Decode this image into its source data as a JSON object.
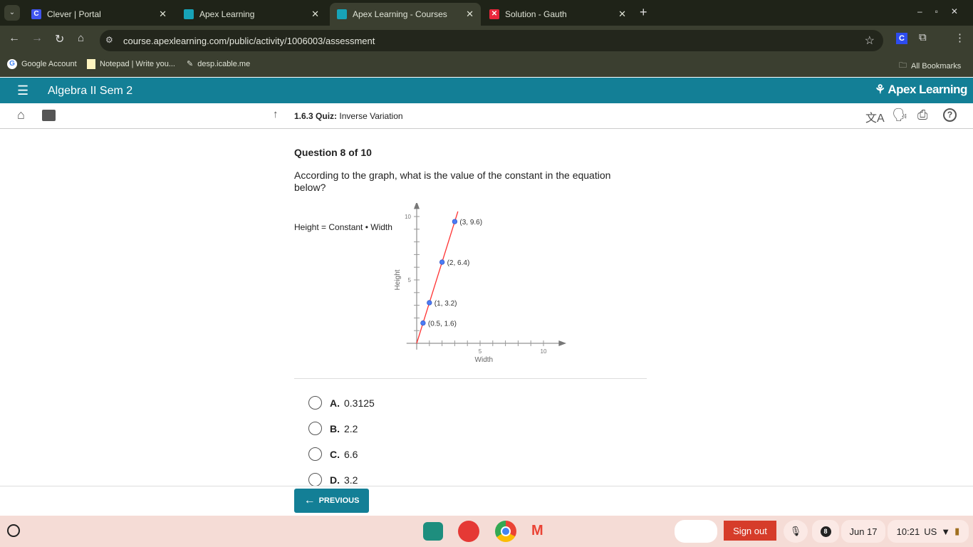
{
  "browser": {
    "tabs": [
      {
        "label": "Clever | Portal",
        "favicon": "C"
      },
      {
        "label": "Apex Learning"
      },
      {
        "label": "Apex Learning - Courses",
        "active": true
      },
      {
        "label": "Solution - Gauth"
      }
    ],
    "url": "course.apexlearning.com/public/activity/1006003/assessment",
    "bookmarks": [
      "Google Account",
      "Notepad | Write you...",
      "desp.icable.me"
    ],
    "all_bookmarks": "All Bookmarks",
    "ext_letter": "C"
  },
  "app": {
    "course_title": "Algebra II Sem 2",
    "brand": "Apex Learning",
    "brand_color": "#137f96",
    "lesson_number": "1.6.3",
    "lesson_type": "Quiz:",
    "lesson_title": "Inverse Variation"
  },
  "question": {
    "counter": "Question 8 of 10",
    "prompt": "According to the graph, what is the value of the constant in the equation below?",
    "equation": "Height = Constant • Width",
    "options": [
      {
        "letter": "A.",
        "text": "0.3125"
      },
      {
        "letter": "B.",
        "text": "2.2"
      },
      {
        "letter": "C.",
        "text": "6.6"
      },
      {
        "letter": "D.",
        "text": "3.2"
      }
    ],
    "previous_label": "PREVIOUS"
  },
  "chart_data": {
    "type": "line",
    "xlabel": "Width",
    "ylabel": "Height",
    "xlim": [
      0,
      10
    ],
    "ylim": [
      0,
      10
    ],
    "x_ticks_labeled": [
      "5",
      "10"
    ],
    "y_ticks_labeled": [
      "5",
      "10"
    ],
    "points": [
      {
        "x": 0.5,
        "y": 1.6,
        "label": "(0.5, 1.6)"
      },
      {
        "x": 1,
        "y": 3.2,
        "label": "(1, 3.2)"
      },
      {
        "x": 2,
        "y": 6.4,
        "label": "(2, 6.4)"
      },
      {
        "x": 3,
        "y": 9.6,
        "label": "(3, 9.6)"
      }
    ],
    "line_color": "#ff3333",
    "point_color": "#4a7cf5"
  },
  "shelf": {
    "sign_out": "Sign out",
    "notifications": "8",
    "date": "Jun 17",
    "time": "10:21",
    "locale": "US"
  }
}
